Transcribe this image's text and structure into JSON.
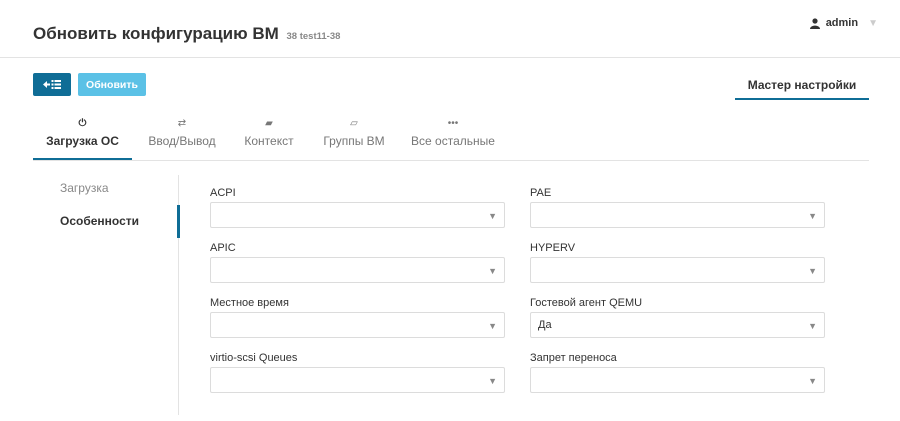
{
  "header": {
    "title": "Обновить конфигурацию ВМ",
    "subtitle": "38 test11-38",
    "user": "admin"
  },
  "toolbar": {
    "back_icon": "back-list-icon",
    "update_label": "Обновить"
  },
  "wizard_tab": "Мастер настройки",
  "tabs": [
    {
      "label": "Загрузка ОС",
      "icon": "power-icon",
      "glyph": "⏻",
      "active": true
    },
    {
      "label": "Ввод/Вывод",
      "icon": "exchange-icon",
      "glyph": "⇄",
      "active": false
    },
    {
      "label": "Контекст",
      "icon": "folder-icon",
      "glyph": "▰",
      "active": false
    },
    {
      "label": "Группы ВМ",
      "icon": "folder-open-icon",
      "glyph": "▱",
      "active": false
    },
    {
      "label": "Все остальные",
      "icon": "ellipsis-icon",
      "glyph": "•••",
      "active": false
    }
  ],
  "sidenav": [
    {
      "label": "Загрузка",
      "active": false
    },
    {
      "label": "Особенности",
      "active": true
    }
  ],
  "fields": [
    {
      "label": "ACPI",
      "value": ""
    },
    {
      "label": "PAE",
      "value": ""
    },
    {
      "label": "APIC",
      "value": ""
    },
    {
      "label": "HYPERV",
      "value": ""
    },
    {
      "label": "Местное время",
      "value": ""
    },
    {
      "label": "Гостевой агент QEMU",
      "value": "Да"
    },
    {
      "label": "virtio-scsi Queues",
      "value": ""
    },
    {
      "label": "Запрет переноса",
      "value": ""
    }
  ],
  "colors": {
    "primary": "#0f6d96",
    "accent": "#5bc1e6",
    "border": "#e3e3e3"
  }
}
